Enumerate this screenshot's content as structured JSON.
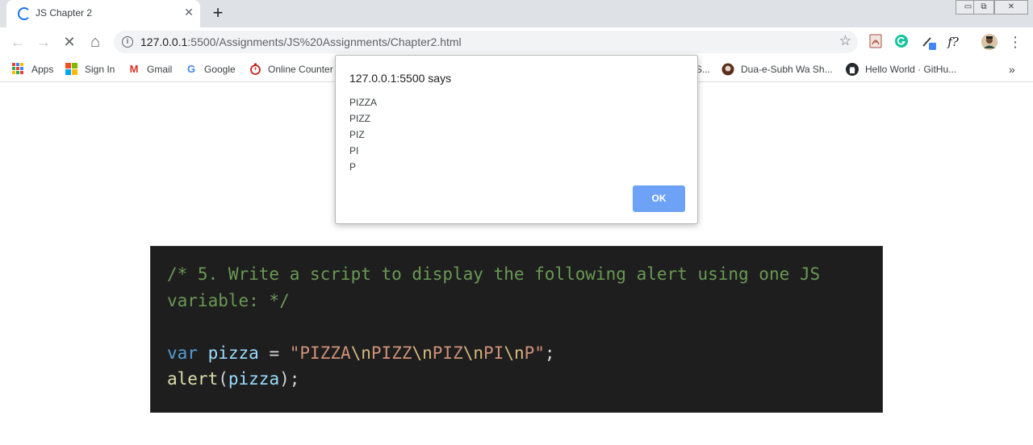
{
  "tab": {
    "title": "JS Chapter 2",
    "close_glyph": "✕"
  },
  "new_tab_glyph": "+",
  "window_controls": {
    "minimize": "▭",
    "restore": "⧉",
    "close": "✕"
  },
  "toolbar": {
    "back_icon": "←",
    "forward_icon": "→",
    "stop_icon": "✕",
    "home_icon": "⌂",
    "url_host": "127.0.0.1",
    "url_rest": ":5500/Assignments/JS%20Assignments/Chapter2.html",
    "info_glyph": "i",
    "star_glyph": "☆",
    "menu_glyph": "⋮",
    "ext_fx_label": "f?"
  },
  "bookmarks": {
    "items": [
      {
        "label": "Apps"
      },
      {
        "label": "Sign In"
      },
      {
        "label": "Gmail",
        "icon_glyph": "M"
      },
      {
        "label": "Google",
        "icon_glyph": "G"
      },
      {
        "label": "Online Counter"
      },
      {
        "label": "S..."
      },
      {
        "label": "Dua-e-Subh Wa Sh..."
      },
      {
        "label": "Hello World · GitHu..."
      }
    ],
    "overflow_glyph": "»"
  },
  "dialog": {
    "title": "127.0.0.1:5500 says",
    "lines": [
      "PIZZA",
      "PIZZ",
      "PIZ",
      "PI",
      "P"
    ],
    "ok_label": "OK"
  },
  "code": {
    "comment_line1": "/* 5. Write a script to display the following alert using one JS",
    "comment_line2": "variable: */",
    "line3_kw": "var",
    "line3_name": "pizza",
    "line3_eq": " = ",
    "line3_str_parts": [
      "\"PIZZA",
      "\\n",
      "PIZZ",
      "\\n",
      "PIZ",
      "\\n",
      "PI",
      "\\n",
      "P\""
    ],
    "line3_end": ";",
    "line4_fn": "alert",
    "line4_open": "(",
    "line4_arg": "pizza",
    "line4_close": ");"
  },
  "colors": {
    "code_bg": "#1e1e1e",
    "comment": "#6a9955",
    "keyword": "#569cd6",
    "variable": "#9cdcfe",
    "string": "#ce9178",
    "escape": "#d7ba7d",
    "function": "#dcdcaa",
    "ok_button": "#6ea2f7",
    "spinner": "#1a73e8"
  }
}
